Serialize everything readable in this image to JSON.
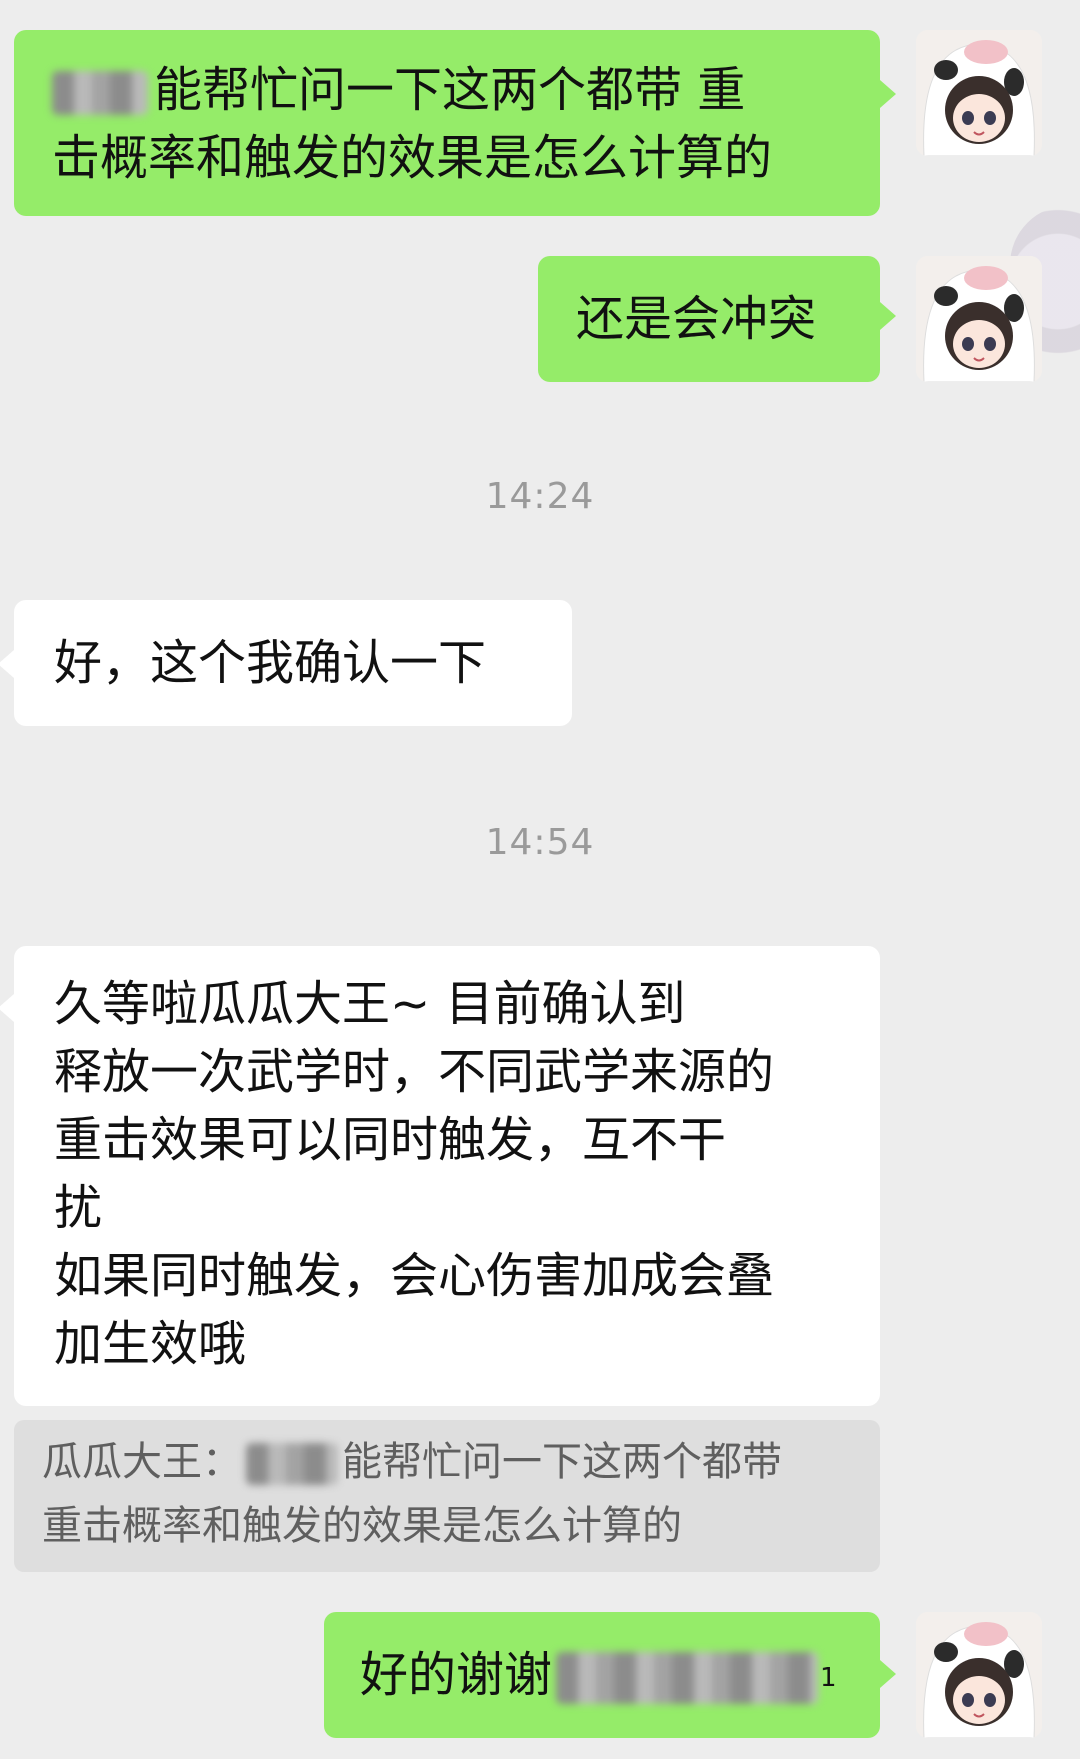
{
  "messages": [
    {
      "direction": "outgoing",
      "lines": [
        "能帮忙问一下这两个都带 重",
        "击概率和触发的效果是怎么计算的"
      ]
    },
    {
      "direction": "outgoing",
      "lines": [
        "还是会冲突"
      ]
    },
    {
      "direction": "incoming",
      "lines": [
        "好，这个我确认一下"
      ]
    },
    {
      "direction": "incoming",
      "lines": [
        "久等啦瓜瓜大王~  目前确认到",
        "释放一次武学时，不同武学来源的",
        "重击效果可以同时触发，互不干",
        "扰",
        "如果同时触发，会心伤害加成会叠",
        "加生效哦"
      ]
    },
    {
      "direction": "outgoing",
      "lines": [
        "好的谢谢"
      ]
    }
  ],
  "timestamps": [
    "14:24",
    "14:54"
  ],
  "quote": {
    "sender": "瓜瓜大王：",
    "line1": "能帮忙问一下这两个都带",
    "line2": "重击概率和触发的效果是怎么计算的"
  },
  "trailing_char": "1",
  "avatar_icon": "cow-hood-girl-avatar-icon",
  "colors": {
    "background": "#ededed",
    "outgoing_bubble": "#95ec69",
    "incoming_bubble": "#ffffff",
    "quote_background": "#dedede"
  }
}
